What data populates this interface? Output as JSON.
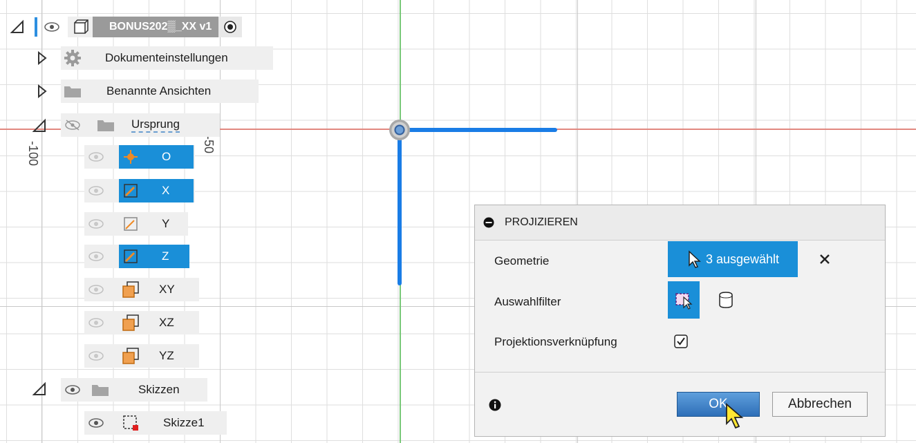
{
  "browser": {
    "root": {
      "label": "BONUS202▒_XX v1"
    },
    "items": [
      {
        "label": "Dokumenteinstellungen"
      },
      {
        "label": "Benannte Ansichten"
      },
      {
        "label": "Ursprung"
      }
    ],
    "origin_items": [
      {
        "label": "O",
        "selected": true
      },
      {
        "label": "X",
        "selected": true
      },
      {
        "label": "Y",
        "selected": false
      },
      {
        "label": "Z",
        "selected": true
      },
      {
        "label": "XY",
        "selected": false
      },
      {
        "label": "XZ",
        "selected": false
      },
      {
        "label": "YZ",
        "selected": false
      }
    ],
    "sketches": {
      "label": "Skizzen",
      "children": [
        {
          "label": "Skizze1"
        }
      ]
    }
  },
  "canvas": {
    "ruler_labels": {
      "minus100": "-100",
      "minus50": "-50"
    }
  },
  "dialog": {
    "title": "PROJIZIEREN",
    "rows": {
      "geometry": {
        "label": "Geometrie",
        "selection": "3 ausgewählt"
      },
      "filter": {
        "label": "Auswahlfilter"
      },
      "link": {
        "label": "Projektionsverknüpfung",
        "checked": true
      }
    },
    "buttons": {
      "ok": "OK",
      "cancel": "Abbrechen"
    }
  },
  "colors": {
    "selection_blue": "#1a8fd8",
    "axis_red": "#e2877f",
    "axis_green": "#78c878",
    "projected_line": "#1a7de6",
    "origin_orange": "#f08a24"
  },
  "icons": [
    "eye-icon",
    "eye-hidden-icon",
    "gear-icon",
    "folder-icon",
    "component-icon",
    "radio-active-icon",
    "origin-point-icon",
    "axis-icon",
    "plane-icon",
    "sketch-icon",
    "cursor-icon",
    "minus-circle-icon",
    "close-icon",
    "window-select-icon",
    "body-filter-icon",
    "checkbox-icon",
    "info-icon"
  ]
}
